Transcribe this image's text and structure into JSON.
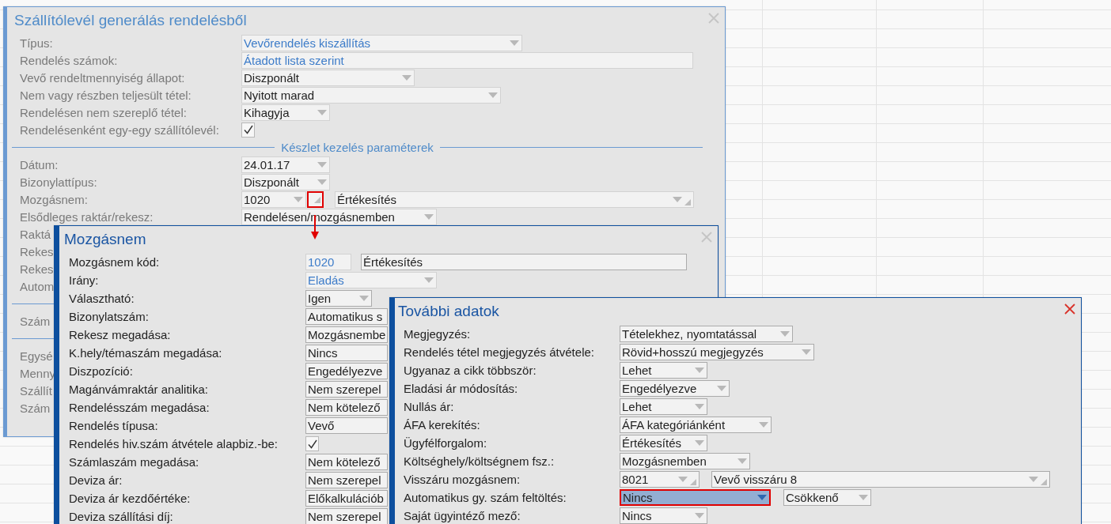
{
  "windows": [
    {
      "title": "Szállítólevél generálás rendelésből",
      "active": false,
      "disabled": true,
      "rows": [
        {
          "kind": "fields",
          "label": "Típus:",
          "fields": [
            {
              "kind": "select",
              "value": "Vevőrendelés kiszállítás",
              "readonly": true
            }
          ]
        },
        {
          "kind": "fields",
          "label": "Rendelés számok:",
          "fields": [
            {
              "kind": "text",
              "value": "Átadott lista szerint",
              "readonly": true
            }
          ]
        },
        {
          "kind": "fields",
          "label": "Vevő rendeltmennyiség állapot:",
          "fields": [
            {
              "kind": "select",
              "value": "Diszponált",
              "readonly": false
            }
          ]
        },
        {
          "kind": "fields",
          "label": "Nem vagy részben teljesült tétel:",
          "fields": [
            {
              "kind": "select",
              "value": "Nyitott marad",
              "readonly": false
            }
          ]
        },
        {
          "kind": "fields",
          "label": "Rendelésen nem szereplő tétel:",
          "fields": [
            {
              "kind": "select",
              "value": "Kihagyja",
              "readonly": false
            }
          ]
        },
        {
          "kind": "checkbox",
          "label": "Rendelésenként egy-egy szállítólevél:",
          "checked": true
        },
        {
          "kind": "section",
          "label": "Készlet kezelés paraméterek"
        },
        {
          "kind": "fields",
          "label": "Dátum:",
          "fields": [
            {
              "kind": "select",
              "value": "24.01.17",
              "readonly": false
            }
          ]
        },
        {
          "kind": "fields",
          "label": "Bizonylattípus:",
          "fields": [
            {
              "kind": "select",
              "value": "Diszponált",
              "readonly": false
            }
          ]
        },
        {
          "kind": "fields",
          "label": "Mozgásnem:",
          "fields": [
            {
              "kind": "select",
              "value": "1020",
              "readonly": false
            },
            {
              "kind": "lookup_button",
              "highlighted": true
            },
            {
              "kind": "select_lookup",
              "value": "Értékesítés",
              "readonly": false
            }
          ]
        },
        {
          "kind": "fields",
          "label": "Elsődleges raktár/rekesz:",
          "fields": [
            {
              "kind": "select",
              "value": "Rendelésen/mozgásnemben",
              "readonly": false
            }
          ]
        },
        {
          "kind": "label",
          "label": "Raktá"
        },
        {
          "kind": "label",
          "label": "Rekes"
        },
        {
          "kind": "label",
          "label": "Rekes"
        },
        {
          "kind": "label",
          "label": "Autom"
        },
        {
          "kind": "divider"
        },
        {
          "kind": "label",
          "label": "Szám"
        },
        {
          "kind": "divider"
        },
        {
          "kind": "label",
          "label": "Egysé"
        },
        {
          "kind": "label",
          "label": "Menny"
        },
        {
          "kind": "label",
          "label": "Szállít"
        },
        {
          "kind": "label",
          "label": "Szám"
        }
      ]
    },
    {
      "title": "Mozgásnem",
      "active": false,
      "disabled": false,
      "rows": [
        {
          "kind": "fields",
          "label": "Mozgásnem kód:",
          "fields": [
            {
              "kind": "text",
              "value": "1020",
              "readonly": true
            },
            {
              "kind": "text",
              "value": "Értékesítés",
              "readonly": false
            }
          ]
        },
        {
          "kind": "fields",
          "label": "Irány:",
          "fields": [
            {
              "kind": "select",
              "value": "Eladás",
              "readonly": true
            }
          ]
        },
        {
          "kind": "fields",
          "label": "Választható:",
          "fields": [
            {
              "kind": "select",
              "value": "Igen",
              "readonly": false
            }
          ]
        },
        {
          "kind": "fields",
          "label": "Bizonylatszám:",
          "fields": [
            {
              "kind": "text",
              "value": "Automatikus s",
              "readonly": false
            }
          ]
        },
        {
          "kind": "fields",
          "label": "Rekesz megadása:",
          "fields": [
            {
              "kind": "text",
              "value": "Mozgásnembe",
              "readonly": false
            }
          ]
        },
        {
          "kind": "fields",
          "label": "K.hely/témaszám megadása:",
          "fields": [
            {
              "kind": "text",
              "value": "Nincs",
              "readonly": false
            }
          ]
        },
        {
          "kind": "fields",
          "label": "Diszpozíció:",
          "fields": [
            {
              "kind": "text",
              "value": "Engedélyezve",
              "readonly": false
            }
          ]
        },
        {
          "kind": "fields",
          "label": "Magánvámraktár analitika:",
          "fields": [
            {
              "kind": "text",
              "value": "Nem szerepel",
              "readonly": false
            }
          ]
        },
        {
          "kind": "fields",
          "label": "Rendelésszám megadása:",
          "fields": [
            {
              "kind": "text",
              "value": "Nem kötelező",
              "readonly": false
            }
          ]
        },
        {
          "kind": "fields",
          "label": "Rendelés típusa:",
          "fields": [
            {
              "kind": "text",
              "value": "Vevő",
              "readonly": false
            }
          ]
        },
        {
          "kind": "checkbox",
          "label": "Rendelés hiv.szám átvétele alapbiz.-be:",
          "checked": true
        },
        {
          "kind": "fields",
          "label": "Számlaszám megadása:",
          "fields": [
            {
              "kind": "text",
              "value": "Nem kötelező",
              "readonly": false
            }
          ]
        },
        {
          "kind": "fields",
          "label": "Deviza ár:",
          "fields": [
            {
              "kind": "text",
              "value": "Nem szerepel",
              "readonly": false
            }
          ]
        },
        {
          "kind": "fields",
          "label": "Deviza ár kezdőértéke:",
          "fields": [
            {
              "kind": "text",
              "value": "Előkalkulációb",
              "readonly": false
            }
          ]
        },
        {
          "kind": "fields",
          "label": "Deviza szállítási díj:",
          "fields": [
            {
              "kind": "text",
              "value": "Nem szerepel",
              "readonly": false
            }
          ]
        }
      ]
    },
    {
      "title": "További adatok",
      "active": true,
      "disabled": false,
      "rows": [
        {
          "kind": "fields",
          "label": "Megjegyzés:",
          "fields": [
            {
              "kind": "select",
              "value": "Tételekhez, nyomtatással",
              "focused": false
            }
          ]
        },
        {
          "kind": "fields",
          "label": "Rendelés tétel megjegyzés átvétele:",
          "fields": [
            {
              "kind": "select",
              "value": "Rövid+hosszú megjegyzés",
              "focused": false
            }
          ]
        },
        {
          "kind": "fields",
          "label": "Ugyanaz a cikk többször:",
          "fields": [
            {
              "kind": "select",
              "value": "Lehet",
              "focused": false
            }
          ]
        },
        {
          "kind": "fields",
          "label": "Eladási ár módosítás:",
          "fields": [
            {
              "kind": "select",
              "value": "Engedélyezve",
              "focused": false
            }
          ]
        },
        {
          "kind": "fields",
          "label": "Nullás ár:",
          "fields": [
            {
              "kind": "select",
              "value": "Lehet",
              "focused": false
            }
          ]
        },
        {
          "kind": "fields",
          "label": "ÁFA kerekítés:",
          "fields": [
            {
              "kind": "select",
              "value": "ÁFA kategóriánként",
              "focused": false
            }
          ]
        },
        {
          "kind": "fields",
          "label": "Ügyfélforgalom:",
          "fields": [
            {
              "kind": "select",
              "value": "Értékesítés",
              "focused": false
            }
          ]
        },
        {
          "kind": "fields",
          "label": "Költséghely/költségnem fsz.:",
          "fields": [
            {
              "kind": "select",
              "value": "Mozgásnemben",
              "focused": false
            }
          ]
        },
        {
          "kind": "fields",
          "label": "Visszáru mozgásnem:",
          "fields": [
            {
              "kind": "select_lookup",
              "value": "8021",
              "focused": false
            },
            {
              "kind": "select_lookup",
              "value": "Vevő visszáru 8",
              "focused": false
            }
          ]
        },
        {
          "kind": "fields",
          "label": "Automatikus gy. szám feltöltés:",
          "fields": [
            {
              "kind": "select",
              "value": "Nincs",
              "focused": true
            },
            {
              "kind": "select",
              "value": "Csökkenő",
              "focused": false
            }
          ]
        },
        {
          "kind": "fields",
          "label": "Saját ügyintéző mező:",
          "fields": [
            {
              "kind": "select",
              "value": "Nincs",
              "focused": false
            }
          ]
        }
      ]
    }
  ]
}
